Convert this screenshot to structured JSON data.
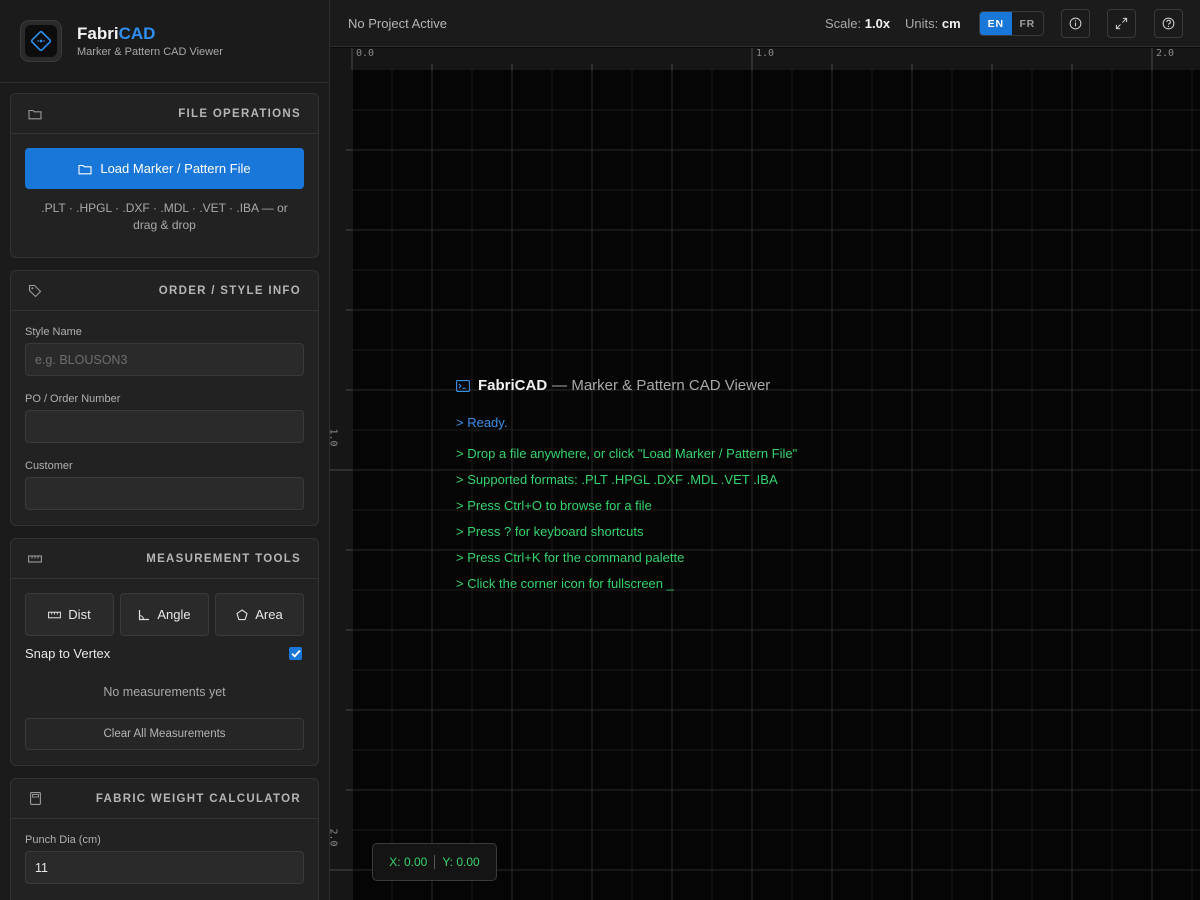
{
  "brand": {
    "title_main": "Fabri",
    "title_accent": "CAD",
    "subtitle": "Marker & Pattern CAD Viewer"
  },
  "panels": {
    "file_ops": {
      "title": "FILE OPERATIONS",
      "icon": "folder-icon",
      "load_label": "Load Marker / Pattern File",
      "hint": ".PLT · .HPGL · .DXF · .MDL · .VET · .IBA — or drag & drop"
    },
    "order_info": {
      "title": "ORDER / STYLE INFO",
      "icon": "tag-icon",
      "style_label": "Style Name",
      "style_placeholder": "e.g. BLOUSON3",
      "style_value": "",
      "po_label": "PO / Order Number",
      "po_value": "",
      "customer_label": "Customer",
      "customer_value": ""
    },
    "measure": {
      "title": "MEASUREMENT TOOLS",
      "icon": "ruler-icon",
      "dist_label": "Dist",
      "angle_label": "Angle",
      "area_label": "Area",
      "snap_label": "Snap to Vertex",
      "snap_checked": true,
      "empty_note": "No measurements yet",
      "clear_label": "Clear All Measurements"
    },
    "fabric": {
      "title": "FABRIC WEIGHT CALCULATOR",
      "icon": "calculator-icon",
      "punch_label": "Punch Dia (cm)",
      "punch_value": "11"
    }
  },
  "topbar": {
    "project": "No Project Active",
    "scale_label": "Scale:",
    "scale_value": "1.0x",
    "units_label": "Units:",
    "units_value": "cm",
    "lang_en": "EN",
    "lang_fr": "FR",
    "active_lang": "EN"
  },
  "rulers": {
    "top": [
      "0.0",
      "1.0",
      "2.0"
    ],
    "left": [
      "1.0",
      "2.0"
    ]
  },
  "console": {
    "title_bold": "FabriCAD",
    "title_rest": "— Marker & Pattern CAD Viewer",
    "ready": "> Ready.",
    "lines": [
      "> Drop a file anywhere, or click \"Load Marker / Pattern File\"",
      "> Supported formats: .PLT .HPGL .DXF .MDL .VET .IBA",
      "> Press Ctrl+O to browse for a file",
      "> Press ? for keyboard shortcuts",
      "> Press Ctrl+K for the command palette",
      "> Click the corner icon for fullscreen _"
    ]
  },
  "coords": {
    "x": "X: 0.00",
    "y": "Y: 0.00"
  },
  "colors": {
    "accent": "#1877d8",
    "console_green": "#35d46d",
    "console_blue": "#3b8fe6"
  }
}
